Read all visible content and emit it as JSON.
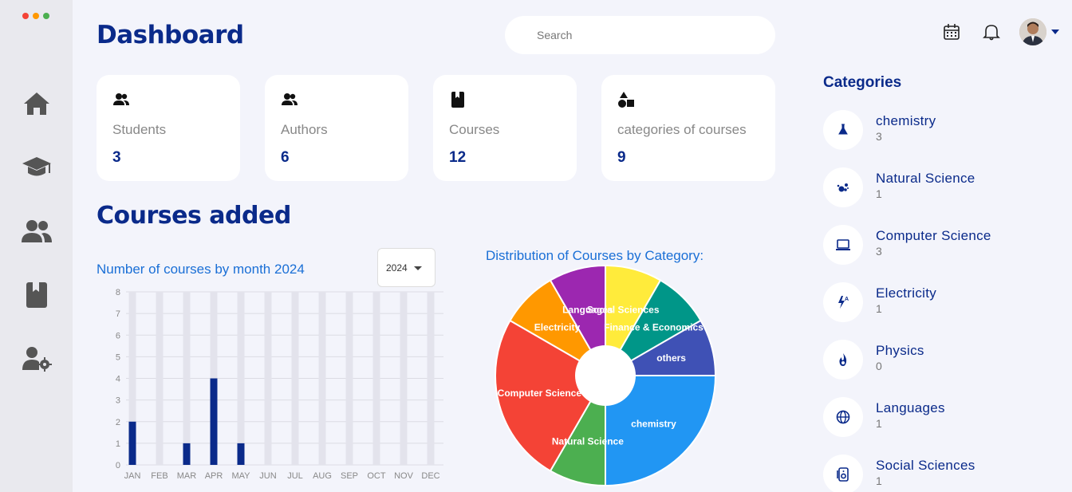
{
  "header": {
    "title": "Dashboard",
    "search_placeholder": "Search"
  },
  "sidebar": {
    "items": [
      {
        "icon": "home-icon"
      },
      {
        "icon": "graduation-cap-icon"
      },
      {
        "icon": "users-icon"
      },
      {
        "icon": "book-icon"
      },
      {
        "icon": "user-gear-icon"
      }
    ]
  },
  "stats": [
    {
      "label": "Students",
      "value": "3",
      "icon": "users-icon"
    },
    {
      "label": "Authors",
      "value": "6",
      "icon": "users-icon"
    },
    {
      "label": "Courses",
      "value": "12",
      "icon": "book-icon"
    },
    {
      "label": "categories of courses",
      "value": "9",
      "icon": "shapes-icon"
    }
  ],
  "section_title": "Courses added",
  "bar_chart": {
    "title": "Number of courses by month 2024",
    "year_select": "2024"
  },
  "pie_chart": {
    "title": "Distribution of Courses by Category:"
  },
  "chart_data": [
    {
      "type": "bar",
      "title": "Number of courses by month 2024",
      "categories": [
        "JAN",
        "FEB",
        "MAR",
        "APR",
        "MAY",
        "JUN",
        "JUL",
        "AUG",
        "SEP",
        "OCT",
        "NOV",
        "DEC"
      ],
      "values": [
        2,
        0,
        1,
        4,
        1,
        0,
        0,
        0,
        0,
        0,
        0,
        0
      ],
      "ylim": [
        0,
        8
      ],
      "yticks": [
        "0",
        "1",
        "2",
        "3",
        "4",
        "5",
        "6",
        "7",
        "8"
      ],
      "grid": true,
      "bar_color": "#0a2a8a",
      "track_color": "#e3e3ec"
    },
    {
      "type": "pie",
      "title": "Distribution of Courses by Category:",
      "slices": [
        {
          "label": "Social Sciences",
          "value": 1,
          "color": "#ffeb3b"
        },
        {
          "label": "Finance & Economics",
          "value": 1,
          "color": "#009688"
        },
        {
          "label": "others",
          "value": 1,
          "color": "#3f51b5"
        },
        {
          "label": "chemistry",
          "value": 3,
          "color": "#2196f3"
        },
        {
          "label": "Natural Science",
          "value": 1,
          "color": "#4caf50"
        },
        {
          "label": "Computer Science",
          "value": 3,
          "color": "#f44336"
        },
        {
          "label": "Electricity",
          "value": 1,
          "color": "#ff9800"
        },
        {
          "label": "Languages",
          "value": 1,
          "color": "#9c27b0"
        }
      ]
    }
  ],
  "categories": {
    "title": "Categories",
    "items": [
      {
        "name": "chemistry",
        "count": "3",
        "icon": "flask-icon"
      },
      {
        "name": "Natural Science",
        "count": "1",
        "icon": "atom-icon"
      },
      {
        "name": "Computer Science",
        "count": "3",
        "icon": "laptop-icon"
      },
      {
        "name": "Electricity",
        "count": "1",
        "icon": "lightning-icon"
      },
      {
        "name": "Physics",
        "count": "0",
        "icon": "fire-icon"
      },
      {
        "name": "Languages",
        "count": "1",
        "icon": "globe-icon"
      },
      {
        "name": "Social Sciences",
        "count": "1",
        "icon": "speaker-icon"
      }
    ]
  },
  "colors": {
    "primary": "#0a2a8a",
    "accent_blue": "#1a6fd6",
    "background": "#f3f4fb"
  }
}
